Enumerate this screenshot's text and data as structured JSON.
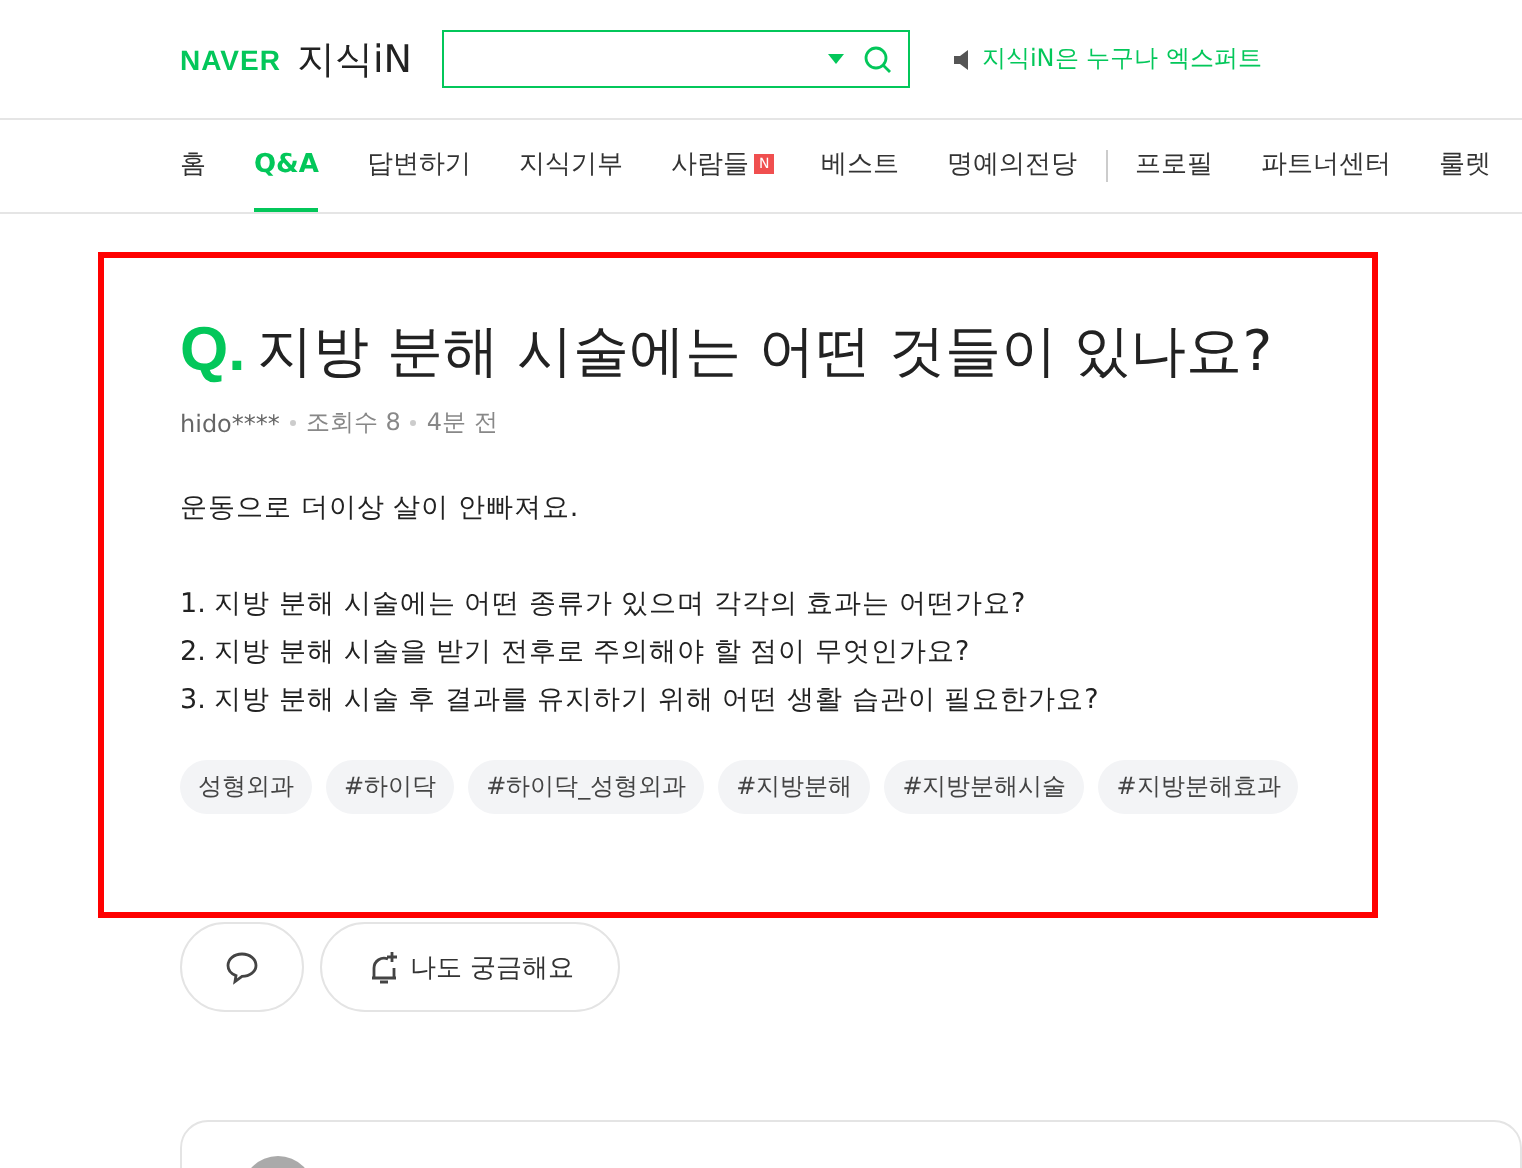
{
  "header": {
    "logo_brand": "NAVER",
    "logo_service": "지식iN",
    "notice": "지식iN은 누구나 엑스퍼트"
  },
  "nav": [
    {
      "label": "홈",
      "selected": false
    },
    {
      "label": "Q&A",
      "selected": true
    },
    {
      "label": "답변하기",
      "selected": false
    },
    {
      "label": "지식기부",
      "selected": false
    },
    {
      "label": "사람들",
      "selected": false,
      "badge": "N"
    },
    {
      "label": "베스트",
      "selected": false
    },
    {
      "label": "명예의전당",
      "selected": false
    },
    {
      "label": "프로필",
      "selected": false
    },
    {
      "label": "파트너센터",
      "selected": false
    },
    {
      "label": "룰렛",
      "selected": false
    }
  ],
  "question": {
    "mark": "Q.",
    "title": "지방 분해 시술에는 어떤 것들이 있나요?",
    "author": "hido****",
    "views": "조회수 8",
    "time": "4분 전",
    "intro": "운동으로 더이상 살이 안빠져요.",
    "items": [
      "1. 지방 분해 시술에는 어떤 종류가 있으며 각각의 효과는 어떤가요?",
      "2. 지방 분해 시술을 받기 전후로 주의해야 할 점이 무엇인가요?",
      "3. 지방 분해 시술 후 결과를 유지하기 위해 어떤 생활 습관이 필요한가요?"
    ],
    "tags": [
      "성형외과",
      "#하이닥",
      "#하이닥_성형외과",
      "#지방분해",
      "#지방분해시술",
      "#지방분해효과"
    ]
  },
  "actions": {
    "curious": "나도 궁금해요"
  }
}
